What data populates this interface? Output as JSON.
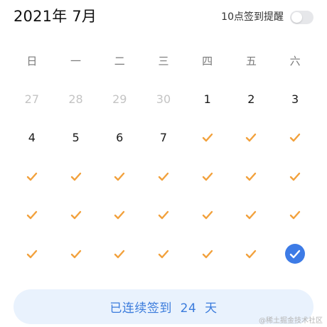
{
  "header": {
    "month_title": "2021年 7月",
    "reminder_label": "10点签到提醒",
    "reminder_enabled": false
  },
  "colors": {
    "check": "#F2A13C",
    "today_circle": "#3D7BE6",
    "streak_bg": "#E9F2FD",
    "streak_text": "#3A7BDC",
    "muted_text": "#C4C4C4"
  },
  "calendar": {
    "weekdays": [
      "日",
      "一",
      "二",
      "三",
      "四",
      "五",
      "六"
    ],
    "days": [
      {
        "label": "27",
        "state": "muted"
      },
      {
        "label": "28",
        "state": "muted"
      },
      {
        "label": "29",
        "state": "muted"
      },
      {
        "label": "30",
        "state": "muted"
      },
      {
        "label": "1",
        "state": "date"
      },
      {
        "label": "2",
        "state": "date"
      },
      {
        "label": "3",
        "state": "date"
      },
      {
        "label": "4",
        "state": "date"
      },
      {
        "label": "5",
        "state": "date"
      },
      {
        "label": "6",
        "state": "date"
      },
      {
        "label": "7",
        "state": "date"
      },
      {
        "label": "",
        "state": "checked"
      },
      {
        "label": "",
        "state": "checked"
      },
      {
        "label": "",
        "state": "checked"
      },
      {
        "label": "",
        "state": "checked"
      },
      {
        "label": "",
        "state": "checked"
      },
      {
        "label": "",
        "state": "checked"
      },
      {
        "label": "",
        "state": "checked"
      },
      {
        "label": "",
        "state": "checked"
      },
      {
        "label": "",
        "state": "checked"
      },
      {
        "label": "",
        "state": "checked"
      },
      {
        "label": "",
        "state": "checked"
      },
      {
        "label": "",
        "state": "checked"
      },
      {
        "label": "",
        "state": "checked"
      },
      {
        "label": "",
        "state": "checked"
      },
      {
        "label": "",
        "state": "checked"
      },
      {
        "label": "",
        "state": "checked"
      },
      {
        "label": "",
        "state": "checked"
      },
      {
        "label": "",
        "state": "checked"
      },
      {
        "label": "",
        "state": "checked"
      },
      {
        "label": "",
        "state": "checked"
      },
      {
        "label": "",
        "state": "checked"
      },
      {
        "label": "",
        "state": "checked"
      },
      {
        "label": "",
        "state": "checked"
      },
      {
        "label": "",
        "state": "today-checked"
      }
    ]
  },
  "streak": {
    "text": "已连续签到  24  天"
  },
  "watermark": "@稀土掘金技术社区"
}
